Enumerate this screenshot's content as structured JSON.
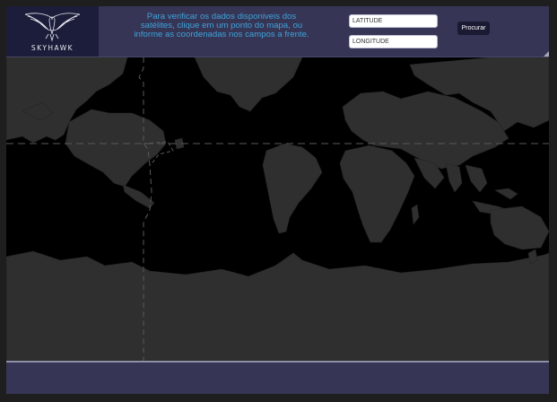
{
  "brand": {
    "name": "SKYHAWK",
    "logo_icon": "hawk-icon"
  },
  "header": {
    "instructions": "Para verificar os dados disponiveis dos satélites, clique em um ponto do mapa, ou informe as coordenadas nos campos a frente."
  },
  "form": {
    "latitude_placeholder": "LATITUDE",
    "longitude_placeholder": "LONGITUDE",
    "search_label": "Procurar"
  },
  "colors": {
    "header_bg": "#363555",
    "logo_bg": "#1c1d3a",
    "instruction_text": "#3fa3d9",
    "land": "#2f2f2f",
    "ocean": "#000000",
    "button_bg": "#1a1a33"
  }
}
